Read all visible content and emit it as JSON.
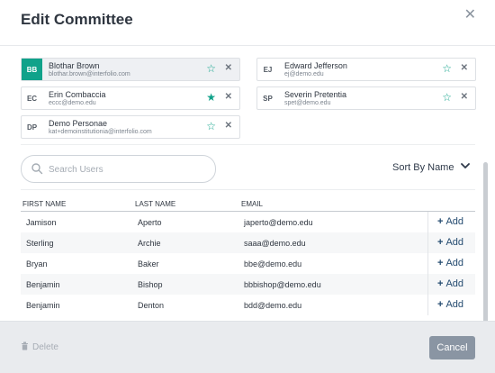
{
  "dialog": {
    "title": "Edit Committee",
    "close_icon": "close-icon"
  },
  "members": [
    {
      "initials": "BB",
      "name": "Blothar Brown",
      "email": "blothar.brown@interfolio.com",
      "starred": false,
      "selected": true
    },
    {
      "initials": "EJ",
      "name": "Edward Jefferson",
      "email": "ej@demo.edu",
      "starred": false,
      "selected": false
    },
    {
      "initials": "EC",
      "name": "Erin Combaccia",
      "email": "eccc@demo.edu",
      "starred": true,
      "selected": false
    },
    {
      "initials": "SP",
      "name": "Severin Pretentia",
      "email": "spet@demo.edu",
      "starred": false,
      "selected": false
    },
    {
      "initials": "DP",
      "name": "Demo Personae",
      "email": "kat+demoinstitutionia@interfolio.com",
      "starred": false,
      "selected": false
    }
  ],
  "search": {
    "placeholder": "Search Users",
    "value": ""
  },
  "sort": {
    "label": "Sort By Name"
  },
  "table": {
    "headers": [
      "FIRST NAME",
      "LAST NAME",
      "EMAIL"
    ],
    "add_label": "Add",
    "rows": [
      {
        "first": "Jamison",
        "last": "Aperto",
        "email": "japerto@demo.edu"
      },
      {
        "first": "Sterling",
        "last": "Archie",
        "email": "saaa@demo.edu"
      },
      {
        "first": "Bryan",
        "last": "Baker",
        "email": "bbe@demo.edu"
      },
      {
        "first": "Benjamin",
        "last": "Bishop",
        "email": "bbbishop@demo.edu"
      },
      {
        "first": "Benjamin",
        "last": "Denton",
        "email": "bdd@demo.edu"
      }
    ]
  },
  "footer": {
    "delete_label": "Delete",
    "cancel_label": "Cancel"
  },
  "colors": {
    "accent": "#10a28a",
    "link": "#234a6f",
    "footer_bg": "#e9ebee",
    "cancel_bg": "#8a95a3"
  }
}
